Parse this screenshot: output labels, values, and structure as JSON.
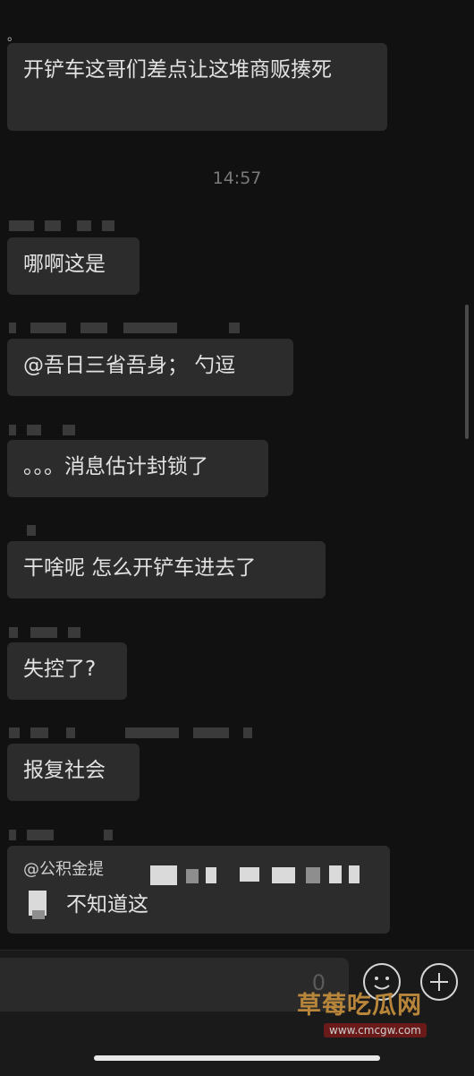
{
  "top_dot": "。",
  "timestamp": "14:57",
  "messages": [
    {
      "text": "开铲车这哥们差点让这堆商贩揍死"
    },
    {
      "text": "哪啊这是"
    },
    {
      "text": "@吾日三省吾身； 勺逗"
    },
    {
      "text": "。。。消息估计封锁了"
    },
    {
      "text": "干啥呢  怎么开铲车进去了"
    },
    {
      "text": "失控了?"
    },
    {
      "text": "报复社会"
    },
    {
      "quote": "@公积金提",
      "text": "不知道这"
    }
  ],
  "input": {
    "hint": "0"
  },
  "icons": [
    "emoji-icon",
    "plus-icon"
  ],
  "watermark": {
    "title": "草莓吃瓜网",
    "url": "www.cmcgw.com"
  },
  "colors": {
    "background": "#111111",
    "bubble": "#2c2c2c",
    "watermark": "#b8863a"
  }
}
